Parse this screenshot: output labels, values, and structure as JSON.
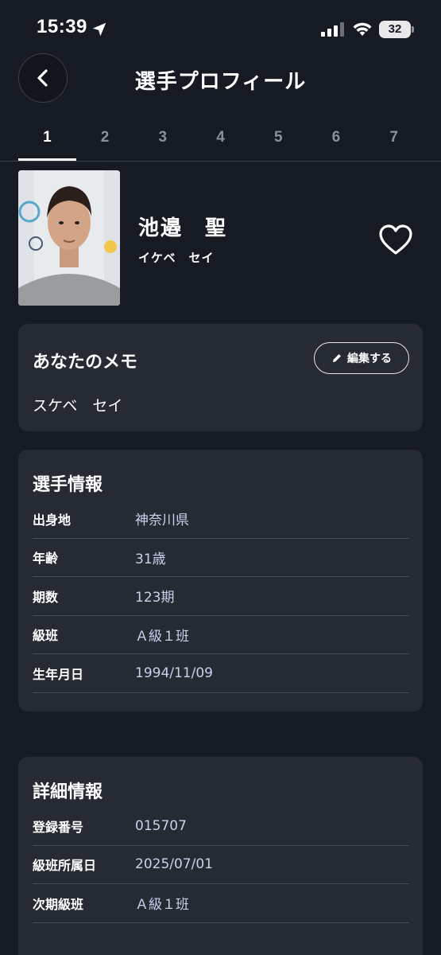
{
  "status_bar": {
    "time": "15:39",
    "battery": "32",
    "icons": [
      "location-arrow-icon",
      "cellular-signal-icon",
      "wifi-icon",
      "battery-icon"
    ]
  },
  "header": {
    "title": "選手プロフィール",
    "back_icon": "chevron-left-icon"
  },
  "tabs": [
    {
      "label": "1",
      "active": true
    },
    {
      "label": "2",
      "active": false
    },
    {
      "label": "3",
      "active": false
    },
    {
      "label": "4",
      "active": false
    },
    {
      "label": "5",
      "active": false
    },
    {
      "label": "6",
      "active": false
    },
    {
      "label": "7",
      "active": false
    }
  ],
  "profile": {
    "name": "池邉　聖",
    "kana": "イケベ　セイ",
    "favorite_icon": "heart-outline-icon"
  },
  "memo": {
    "title": "あなたのメモ",
    "edit_label": "編集する",
    "edit_icon": "pencil-icon",
    "text": "スケベ　セイ"
  },
  "player_info": {
    "title": "選手情報",
    "rows": [
      {
        "label": "出身地",
        "value": "神奈川県"
      },
      {
        "label": "年齢",
        "value": "31歳"
      },
      {
        "label": "期数",
        "value": "123期"
      },
      {
        "label": "級班",
        "value": "Ａ級１班"
      },
      {
        "label": "生年月日",
        "value": "1994/11/09"
      }
    ]
  },
  "detail_info": {
    "title": "詳細情報",
    "rows": [
      {
        "label": "登録番号",
        "value": "015707"
      },
      {
        "label": "級班所属日",
        "value": "2025/07/01"
      },
      {
        "label": "次期級班",
        "value": "Ａ級１班"
      }
    ]
  },
  "colors": {
    "background": "#161a22",
    "card": "#262a33",
    "value_text": "#c8d2ec",
    "divider": "#474c57"
  }
}
